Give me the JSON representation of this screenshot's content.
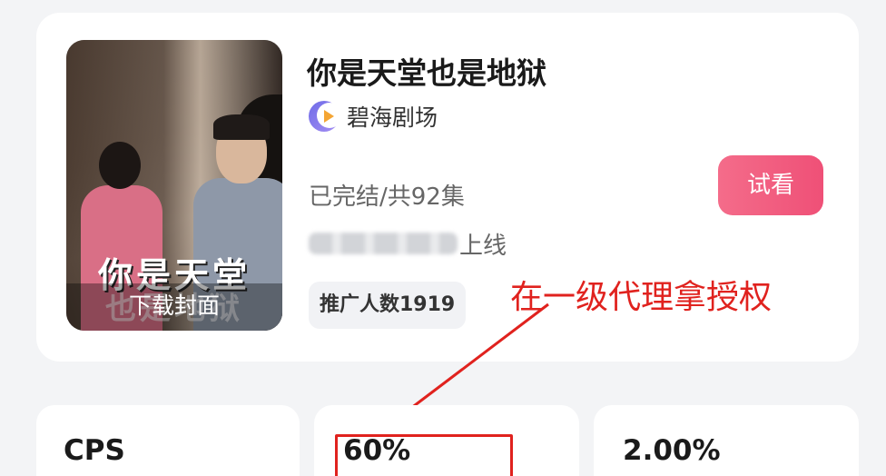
{
  "drama": {
    "title": "你是天堂也是地狱",
    "platform": "碧海剧场",
    "status": "已完结/共92集",
    "online_suffix": "上线",
    "promoters": "推广人数1919",
    "trial_label": "试看"
  },
  "cover": {
    "title_line1": "你是天堂",
    "title_line2": "也是地狱",
    "download_label": "下载封面"
  },
  "annotation": {
    "text": "在一级代理拿授权",
    "color": "#e0221e"
  },
  "stats": [
    {
      "value": "CPS"
    },
    {
      "value": "60%"
    },
    {
      "value": "2.00%"
    }
  ],
  "colors": {
    "accent": "#ef5077",
    "background": "#f3f4f6"
  },
  "icons": {
    "platform_logo": "moon-play-icon",
    "arrow": "red-arrow-icon"
  }
}
